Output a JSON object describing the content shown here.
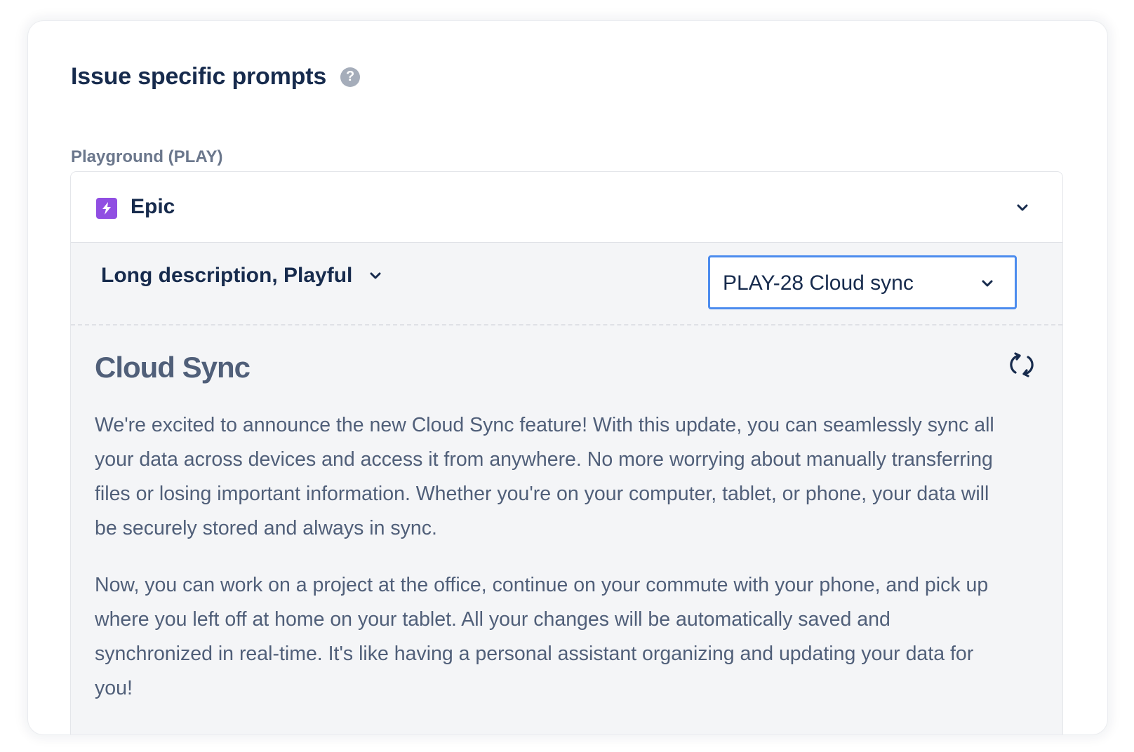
{
  "section": {
    "title": "Issue specific prompts",
    "help_icon": "question-circle-icon",
    "project_label": "Playground (PLAY)"
  },
  "issue_type": {
    "label": "Epic",
    "icon": "lightning-bolt-icon",
    "icon_color": "#904ee2"
  },
  "prompt_controls": {
    "tone_select_value": "Long description, Playful",
    "issue_select_value": "PLAY-28 Cloud sync",
    "focus_color": "#4c8cee"
  },
  "generated": {
    "title": "Cloud Sync",
    "paragraphs": [
      "We're excited to announce the new Cloud Sync feature! With this update, you can seamlessly sync all your data across devices and access it from anywhere. No more worrying about manually transferring files or losing important information. Whether you're on your computer, tablet, or phone, your data will be securely stored and always in sync.",
      "Now, you can work on a project at the office, continue on your commute with your phone, and pick up where you left off at home on your tablet. All your changes will be automatically saved and synchronized in real-time. It's like having a personal assistant organizing and updating your data for you!"
    ]
  }
}
